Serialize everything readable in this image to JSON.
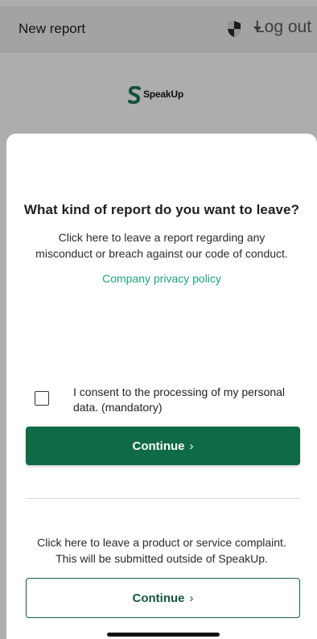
{
  "header": {
    "title": "New report",
    "logout_label": "Log out"
  },
  "logo": {
    "text": "SpeakUp",
    "brand_color": "#1a7a52"
  },
  "sheet": {
    "title": "What kind of report do you want to leave?",
    "description_lines": [
      "Click here to leave a report regarding any",
      "misconduct or breach against our code of conduct."
    ],
    "privacy_link": "Company privacy policy",
    "consent": {
      "checked": false,
      "label_lines": [
        "I consent to the processing of my personal",
        "data. (mandatory)"
      ]
    },
    "primary_button": "Continue",
    "complaint_lines": [
      "Click here to leave a product or service complaint.",
      "This will be submitted outside of SpeakUp."
    ],
    "secondary_button": "Continue"
  },
  "colors": {
    "primary": "#0f6a46",
    "link": "#1fa67a"
  }
}
